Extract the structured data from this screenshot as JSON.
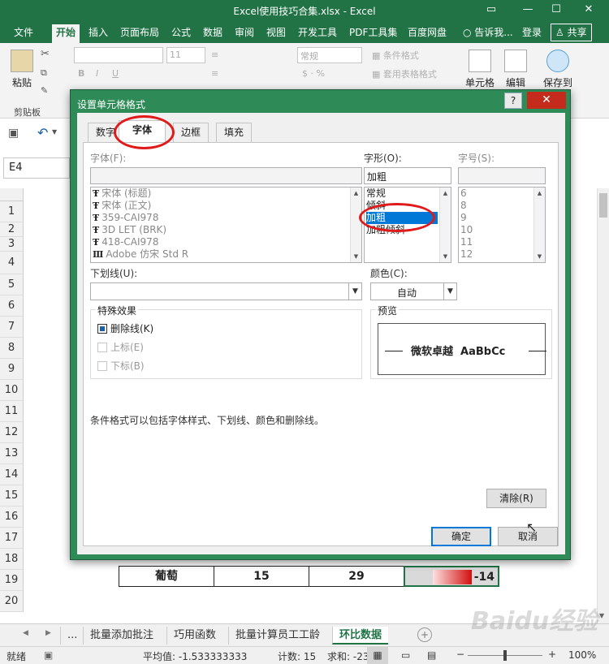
{
  "window": {
    "title": "Excel使用技巧合集.xlsx - Excel",
    "restore_icon": "restore-icon",
    "minimize_icon": "minimize-icon",
    "maximize_icon": "maximize-icon",
    "close_icon": "close-icon"
  },
  "ribbon_tabs": [
    "文件",
    "开始",
    "插入",
    "页面布局",
    "公式",
    "数据",
    "审阅",
    "视图",
    "开发工具",
    "PDF工具集",
    "百度网盘",
    "告诉我...",
    "登录",
    "共享"
  ],
  "ribbon": {
    "paste_label": "粘贴",
    "clipboard_group": "剪贴板",
    "font_size": "11",
    "number_format": "常规",
    "conditional_format": "条件格式",
    "table_format": "套用表格格式",
    "cell_label": "单元格",
    "edit_label": "编辑",
    "save_to_label": "保存到"
  },
  "name_box": "E4",
  "row_numbers": [
    "1",
    "2",
    "3",
    "4",
    "5",
    "6",
    "7",
    "8",
    "9",
    "10",
    "11",
    "12",
    "13",
    "14",
    "15",
    "16",
    "17",
    "18",
    "19",
    "20"
  ],
  "sheet_row_18": {
    "name": "葡萄",
    "b": "15",
    "c": "29",
    "e": "-14"
  },
  "sheet_tabs": [
    "...",
    "批量添加批注",
    "巧用函数",
    "批量计算员工工龄",
    "环比数据"
  ],
  "status": {
    "ready": "就绪",
    "average": "平均值: -1.533333333",
    "count": "计数: 15",
    "sum": "求和: -23",
    "zoom": "100%"
  },
  "dialog": {
    "title": "设置单元格格式",
    "help": "?",
    "tabs": [
      "数字",
      "字体",
      "边框",
      "填充"
    ],
    "font_label": "字体(F):",
    "font_input": "",
    "font_list": [
      "宋体 (标题)",
      "宋体 (正文)",
      "359-CAI978",
      "3D LET (BRK)",
      "418-CAI978",
      "Adobe 仿宋 Std R"
    ],
    "style_label": "字形(O):",
    "style_input": "加粗",
    "style_list": [
      "常规",
      "倾斜",
      "加粗",
      "加粗倾斜"
    ],
    "size_label": "字号(S):",
    "size_input": "",
    "size_list": [
      "6",
      "8",
      "9",
      "10",
      "11",
      "12"
    ],
    "underline_label": "下划线(U):",
    "underline_value": "",
    "color_label": "颜色(C):",
    "color_value": "自动",
    "effects_label": "特殊效果",
    "strikethrough": "删除线(K)",
    "superscript": "上标(E)",
    "subscript": "下标(B)",
    "preview_label": "预览",
    "preview_text": "微软卓越  AaBbCc",
    "note": "条件格式可以包括字体样式、下划线、颜色和删除线。",
    "clear_button": "清除(R)",
    "ok_button": "确定",
    "cancel_button": "取消"
  },
  "colors": {
    "excel_green": "#217346",
    "selection_blue": "#0078d7",
    "annotation_red": "#e01a1a",
    "close_red": "#c42b1c"
  },
  "watermark": "Baidu经验"
}
